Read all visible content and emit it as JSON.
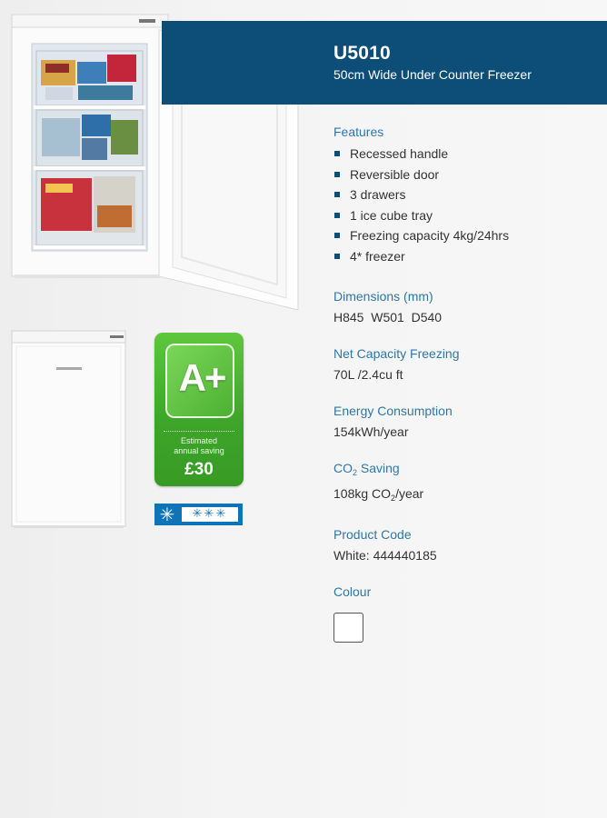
{
  "product": {
    "model": "U5010",
    "subtitle": "50cm Wide Under Counter Freezer"
  },
  "features": {
    "heading": "Features",
    "items": [
      "Recessed handle",
      "Reversible door",
      "3 drawers",
      "1 ice cube tray",
      "Freezing capacity 4kg/24hrs",
      "4* freezer"
    ]
  },
  "dimensions": {
    "heading": "Dimensions (mm)",
    "value": "H845  W501  D540"
  },
  "capacity": {
    "heading": "Net Capacity Freezing",
    "value": "70L /2.4cu ft"
  },
  "energy": {
    "heading": "Energy Consumption",
    "value": "154kWh/year"
  },
  "co2": {
    "heading_prefix": "CO",
    "heading_sub": "2",
    "heading_suffix": " Saving",
    "value_prefix": "108kg CO",
    "value_sub": "2",
    "value_suffix": "/year"
  },
  "product_code": {
    "heading": "Product Code",
    "value": "White: 444440185"
  },
  "colour": {
    "heading": "Colour",
    "swatch_color": "#ffffff"
  },
  "energy_label": {
    "grade": "A+",
    "caption_line1": "Estimated",
    "caption_line2": "annual saving",
    "saving": "£30"
  },
  "star_rating": {
    "single_star": "✳",
    "triple_star": "✳✳✳"
  },
  "brand_colors": {
    "header": "#0d4e78",
    "heading_text": "#2f77a6",
    "energy_green": "#4cb131",
    "star_blue": "#0f73b7"
  }
}
